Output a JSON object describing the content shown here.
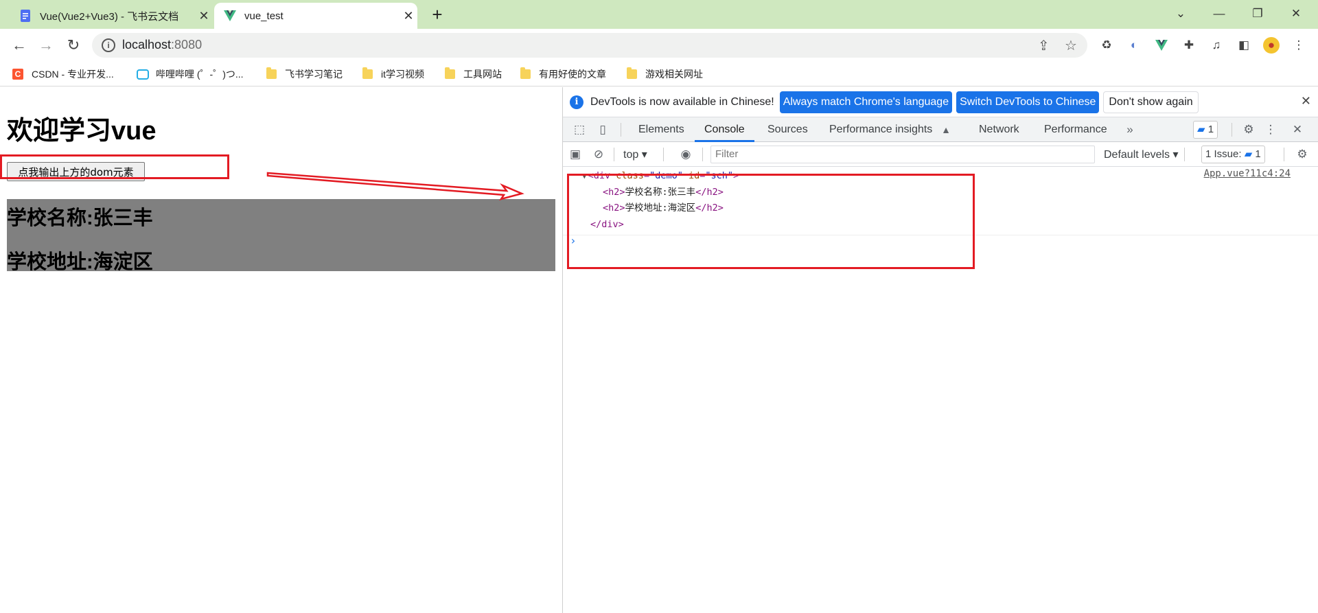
{
  "browser": {
    "tabs": [
      {
        "title": "Vue(Vue2+Vue3) - 飞书云文档",
        "icon": "docs-icon"
      },
      {
        "title": "vue_test",
        "icon": "vue-icon"
      }
    ],
    "url_host": "localhost",
    "url_port": ":8080",
    "bookmarks": [
      "CSDN - 专业开发...",
      "哔哩哔哩 (゜-゜)つ...",
      "飞书学习笔记",
      "it学习视频",
      "工具网站",
      "有用好使的文章",
      "游戏相关网址"
    ]
  },
  "page": {
    "heading": "欢迎学习vue",
    "button_label": "点我输出上方的dom元素",
    "school_name": "学校名称:张三丰",
    "school_address": "学校地址:海淀区"
  },
  "devtools": {
    "infobar": {
      "message": "DevTools is now available in Chinese!",
      "match_button": "Always match Chrome's language",
      "switch_button": "Switch DevTools to Chinese",
      "dismiss_button": "Don't show again"
    },
    "tabs": [
      "Elements",
      "Console",
      "Sources",
      "Performance insights",
      "Network",
      "Performance"
    ],
    "active_tab": "Console",
    "messages_count": "1",
    "context": "top",
    "filter_placeholder": "Filter",
    "levels": "Default levels",
    "issues_label": "1 Issue:",
    "issues_count": "1",
    "log_source": "App.vue?11c4:24",
    "log": {
      "open_tag": "div",
      "attr1_name": "class",
      "attr1_value": "\"demo\"",
      "attr2_name": "id",
      "attr2_value": "\"sch\"",
      "child_tag": "h2",
      "child1_text": "学校名称:张三丰",
      "child2_text": "学校地址:海淀区"
    }
  },
  "colors": {
    "tabbar": "#cfe8bf",
    "accent": "#1a73e8",
    "annotation": "#e31b23",
    "demo_bg": "#808080"
  }
}
